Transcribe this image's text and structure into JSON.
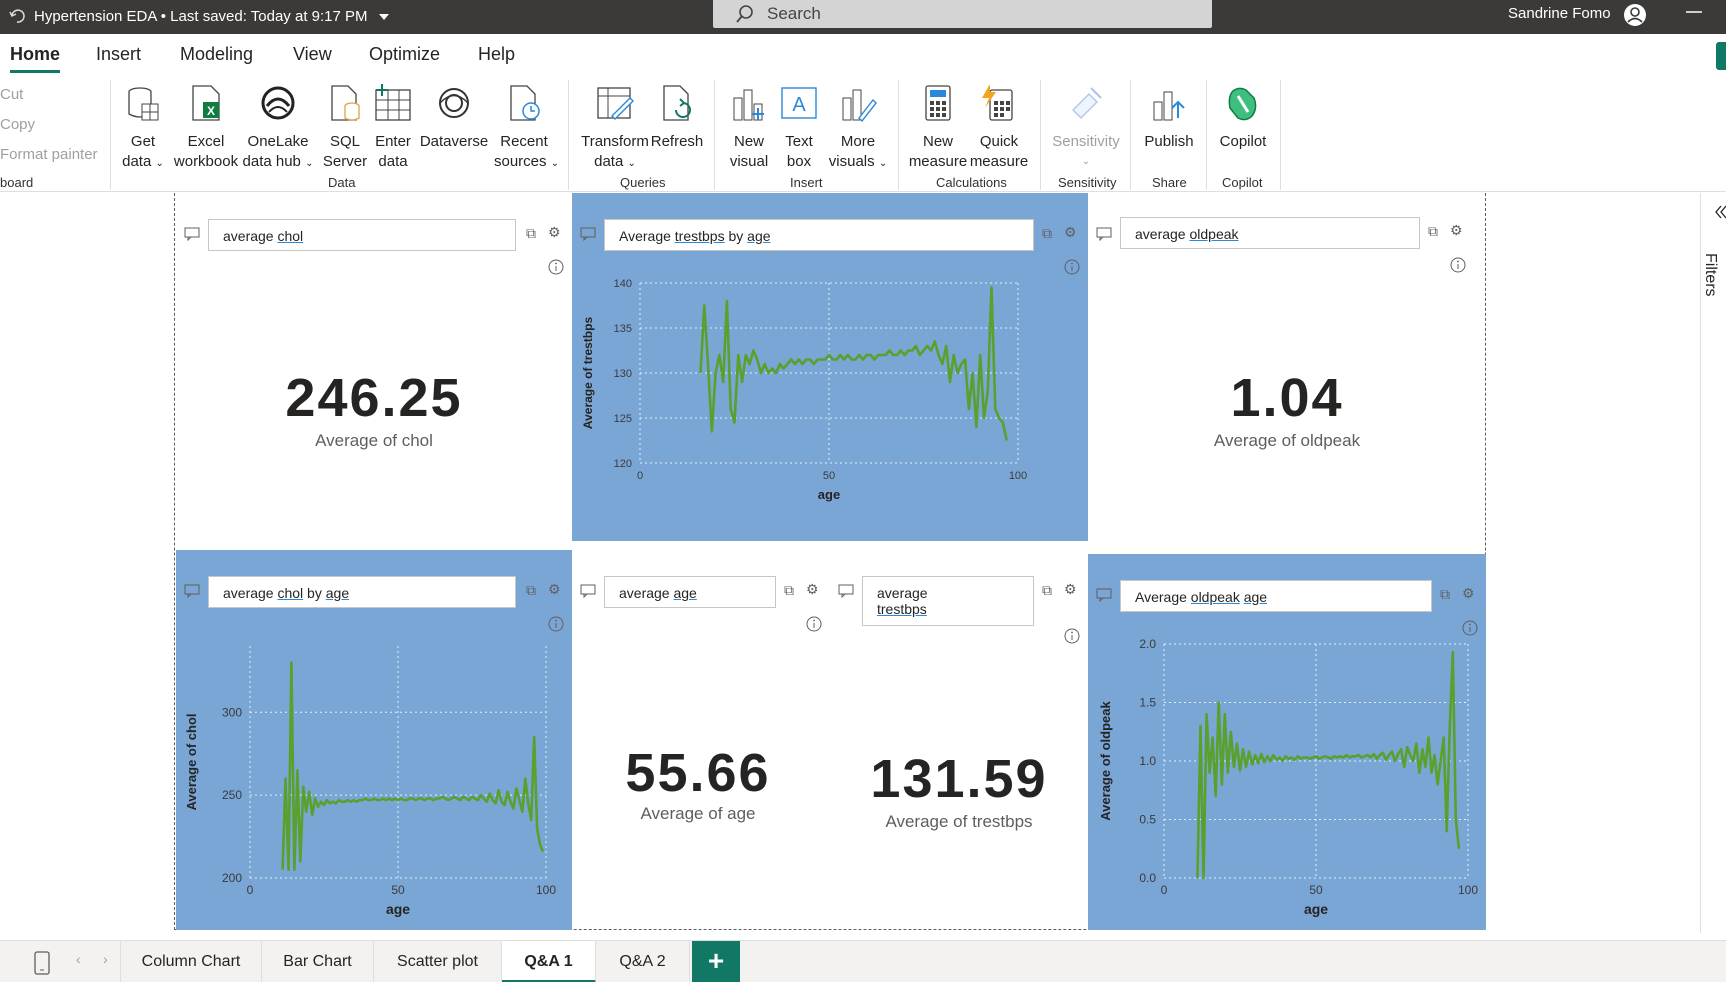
{
  "titlebar": {
    "file_title": "Hypertension EDA",
    "saved_status": "Last saved: Today at 9:17 PM",
    "search_placeholder": "Search",
    "user_name": "Sandrine Fomo"
  },
  "ribbon_tabs": [
    "Home",
    "Insert",
    "Modeling",
    "View",
    "Optimize",
    "Help"
  ],
  "clipboard": {
    "cut": "Cut",
    "copy": "Copy",
    "format_painter": "Format painter",
    "group": "board"
  },
  "ribbon": {
    "data": {
      "get_data": [
        "Get",
        "data"
      ],
      "excel": [
        "Excel",
        "workbook"
      ],
      "onelake": [
        "OneLake",
        "data hub"
      ],
      "sql": [
        "SQL",
        "Server"
      ],
      "enter": [
        "Enter",
        "data"
      ],
      "dataverse": "Dataverse",
      "recent": [
        "Recent",
        "sources"
      ],
      "group": "Data"
    },
    "queries": {
      "transform": [
        "Transform",
        "data"
      ],
      "refresh": "Refresh",
      "group": "Queries"
    },
    "insert": {
      "new_visual": [
        "New",
        "visual"
      ],
      "text_box": [
        "Text",
        "box"
      ],
      "more_visuals": [
        "More",
        "visuals"
      ],
      "group": "Insert"
    },
    "calculations": {
      "new_measure": [
        "New",
        "measure"
      ],
      "quick_measure": [
        "Quick",
        "measure"
      ],
      "group": "Calculations"
    },
    "sensitivity": {
      "label": "Sensitivity",
      "group": "Sensitivity"
    },
    "share": {
      "publish": "Publish",
      "group": "Share"
    },
    "copilot": {
      "label": "Copilot",
      "group": "Copilot"
    }
  },
  "filters_label": "Filters",
  "visuals": {
    "chol_card": {
      "query_plain": "average ",
      "query_u": "chol",
      "value": "246.25",
      "label": "Average of chol"
    },
    "trestbps_chart": {
      "q1": "Average ",
      "q2": "trestbps",
      "q3": " by ",
      "q4": "age"
    },
    "oldpeak_card": {
      "query_plain": "average ",
      "query_u": "oldpeak",
      "value": "1.04",
      "label": "Average of oldpeak"
    },
    "chol_chart": {
      "q1": "average ",
      "q2": "chol",
      "q3": " by ",
      "q4": "age"
    },
    "age_card": {
      "query_plain": "average ",
      "query_u": "age",
      "value": "55.66",
      "label": "Average of age"
    },
    "trestbps_card": {
      "query_line1": "average",
      "query_u": "trestbps",
      "value": "131.59",
      "label": "Average of trestbps"
    },
    "oldpeak_chart": {
      "q1": "Average ",
      "q2": "oldpeak",
      "q3": " ",
      "q4": "age"
    }
  },
  "chart_data": [
    {
      "type": "line",
      "xlabel": "age",
      "ylabel": "Average of trestbps",
      "xlim": [
        0,
        100
      ],
      "ylim": [
        120,
        140
      ],
      "xticks": [
        0,
        50,
        100
      ],
      "yticks": [
        120,
        125,
        130,
        135,
        140
      ],
      "series": [
        {
          "color": "#5aa02c",
          "x": [
            16,
            17,
            18,
            19,
            20,
            21,
            22,
            23,
            24,
            25,
            26,
            27,
            28,
            29,
            30,
            31,
            32,
            33,
            34,
            35,
            36,
            37,
            38,
            39,
            40,
            41,
            42,
            43,
            44,
            45,
            46,
            47,
            48,
            49,
            50,
            51,
            52,
            53,
            54,
            55,
            56,
            57,
            58,
            59,
            60,
            61,
            62,
            63,
            64,
            65,
            66,
            67,
            68,
            69,
            70,
            71,
            72,
            73,
            74,
            75,
            76,
            77,
            78,
            79,
            80,
            81,
            82,
            83,
            84,
            85,
            86,
            87,
            88,
            89,
            90,
            91,
            92,
            93,
            94,
            95,
            96,
            97
          ],
          "y": [
            130,
            137.5,
            131,
            123.5,
            130,
            132,
            129,
            138,
            126,
            124.5,
            132,
            129,
            132,
            131,
            132.5,
            131.5,
            130,
            131,
            130,
            130.5,
            130,
            131,
            130.5,
            131,
            131.5,
            131,
            131.5,
            131,
            131.5,
            131.5,
            131,
            131.5,
            131.5,
            131.5,
            132,
            131.5,
            131.5,
            132,
            131.5,
            132,
            131.5,
            131.5,
            132,
            131.5,
            132,
            132,
            131.5,
            132,
            132,
            132,
            132.5,
            132,
            132,
            132.5,
            132,
            132.5,
            132.5,
            133,
            132,
            132.5,
            133,
            132.5,
            133.5,
            132,
            131,
            133,
            129,
            132,
            130,
            131,
            131.5,
            126,
            130,
            124,
            132,
            125,
            128,
            139.5,
            126,
            125,
            124.5,
            122.5
          ]
        }
      ]
    },
    {
      "type": "line",
      "xlabel": "age",
      "ylabel": "Average of chol",
      "xlim": [
        0,
        100
      ],
      "ylim": [
        200,
        340
      ],
      "xticks": [
        0,
        50,
        100
      ],
      "yticks": [
        200,
        250,
        300
      ],
      "series": [
        {
          "color": "#5aa02c",
          "x": [
            11,
            12,
            13,
            14,
            15,
            16,
            17,
            18,
            19,
            20,
            21,
            22,
            23,
            24,
            25,
            26,
            27,
            28,
            29,
            30,
            31,
            32,
            33,
            34,
            35,
            36,
            37,
            38,
            39,
            40,
            41,
            42,
            43,
            44,
            45,
            46,
            47,
            48,
            49,
            50,
            51,
            52,
            53,
            54,
            55,
            56,
            57,
            58,
            59,
            60,
            61,
            62,
            63,
            64,
            65,
            66,
            67,
            68,
            69,
            70,
            71,
            72,
            73,
            74,
            75,
            76,
            77,
            78,
            79,
            80,
            81,
            82,
            83,
            84,
            85,
            86,
            87,
            88,
            89,
            90,
            91,
            92,
            93,
            94,
            95,
            96,
            97,
            98,
            99
          ],
          "y": [
            205,
            260,
            205,
            330,
            205,
            265,
            210,
            255,
            240,
            252,
            238,
            248,
            243,
            246,
            244,
            247,
            245,
            246,
            245,
            247,
            246,
            246,
            247,
            246,
            247,
            246,
            247,
            247,
            248,
            247,
            247,
            248,
            247,
            247,
            248,
            247,
            248,
            247,
            248,
            247,
            248,
            247,
            247,
            248,
            248,
            247,
            248,
            248,
            247,
            248,
            248,
            247,
            248,
            248,
            249,
            248,
            247,
            248,
            249,
            248,
            247,
            249,
            248,
            247,
            249,
            248,
            247,
            250,
            248,
            246,
            251,
            247,
            245,
            253,
            246,
            244,
            252,
            246,
            242,
            254,
            247,
            240,
            260,
            245,
            235,
            285,
            230,
            220,
            216
          ]
        }
      ]
    },
    {
      "type": "line",
      "xlabel": "age",
      "ylabel": "Average of oldpeak",
      "xlim": [
        0,
        100
      ],
      "ylim": [
        0,
        2
      ],
      "xticks": [
        0,
        50,
        100
      ],
      "yticks": [
        0.0,
        0.5,
        1.0,
        1.5,
        2.0
      ],
      "series": [
        {
          "color": "#5aa02c",
          "x": [
            11,
            12,
            13,
            14,
            15,
            16,
            17,
            18,
            19,
            20,
            21,
            22,
            23,
            24,
            25,
            26,
            27,
            28,
            29,
            30,
            31,
            32,
            33,
            34,
            35,
            36,
            37,
            38,
            39,
            40,
            41,
            42,
            43,
            44,
            45,
            46,
            47,
            48,
            49,
            50,
            51,
            52,
            53,
            54,
            55,
            56,
            57,
            58,
            59,
            60,
            61,
            62,
            63,
            64,
            65,
            66,
            67,
            68,
            69,
            70,
            71,
            72,
            73,
            74,
            75,
            76,
            77,
            78,
            79,
            80,
            81,
            82,
            83,
            84,
            85,
            86,
            87,
            88,
            89,
            90,
            91,
            92,
            93,
            94,
            95,
            96,
            97
          ],
          "y": [
            0.0,
            1.3,
            0.0,
            1.4,
            0.9,
            1.2,
            0.7,
            1.5,
            0.8,
            1.4,
            0.9,
            1.25,
            0.95,
            1.15,
            0.92,
            1.1,
            0.95,
            1.08,
            0.97,
            1.05,
            0.98,
            1.06,
            0.99,
            1.04,
            1.0,
            1.05,
            1.01,
            1.03,
            1.0,
            1.04,
            1.02,
            1.03,
            1.01,
            1.04,
            1.02,
            1.03,
            1.03,
            1.02,
            1.03,
            1.04,
            1.02,
            1.03,
            1.04,
            1.03,
            1.02,
            1.04,
            1.03,
            1.04,
            1.03,
            1.05,
            1.03,
            1.04,
            1.04,
            1.05,
            1.03,
            1.04,
            1.05,
            1.03,
            1.06,
            1.02,
            1.05,
            1.07,
            1.01,
            1.05,
            1.08,
            1.0,
            1.06,
            1.1,
            0.95,
            1.12,
            1.05,
            1.0,
            1.15,
            0.9,
            1.1,
            0.95,
            1.2,
            0.9,
            1.05,
            0.8,
            1.0,
            1.2,
            0.4,
            1.3,
            1.93,
            0.5,
            0.25
          ]
        }
      ]
    }
  ],
  "page_tabs": [
    "Column Chart",
    "Bar Chart",
    "Scatter plot",
    "Q&A 1",
    "Q&A 2"
  ]
}
